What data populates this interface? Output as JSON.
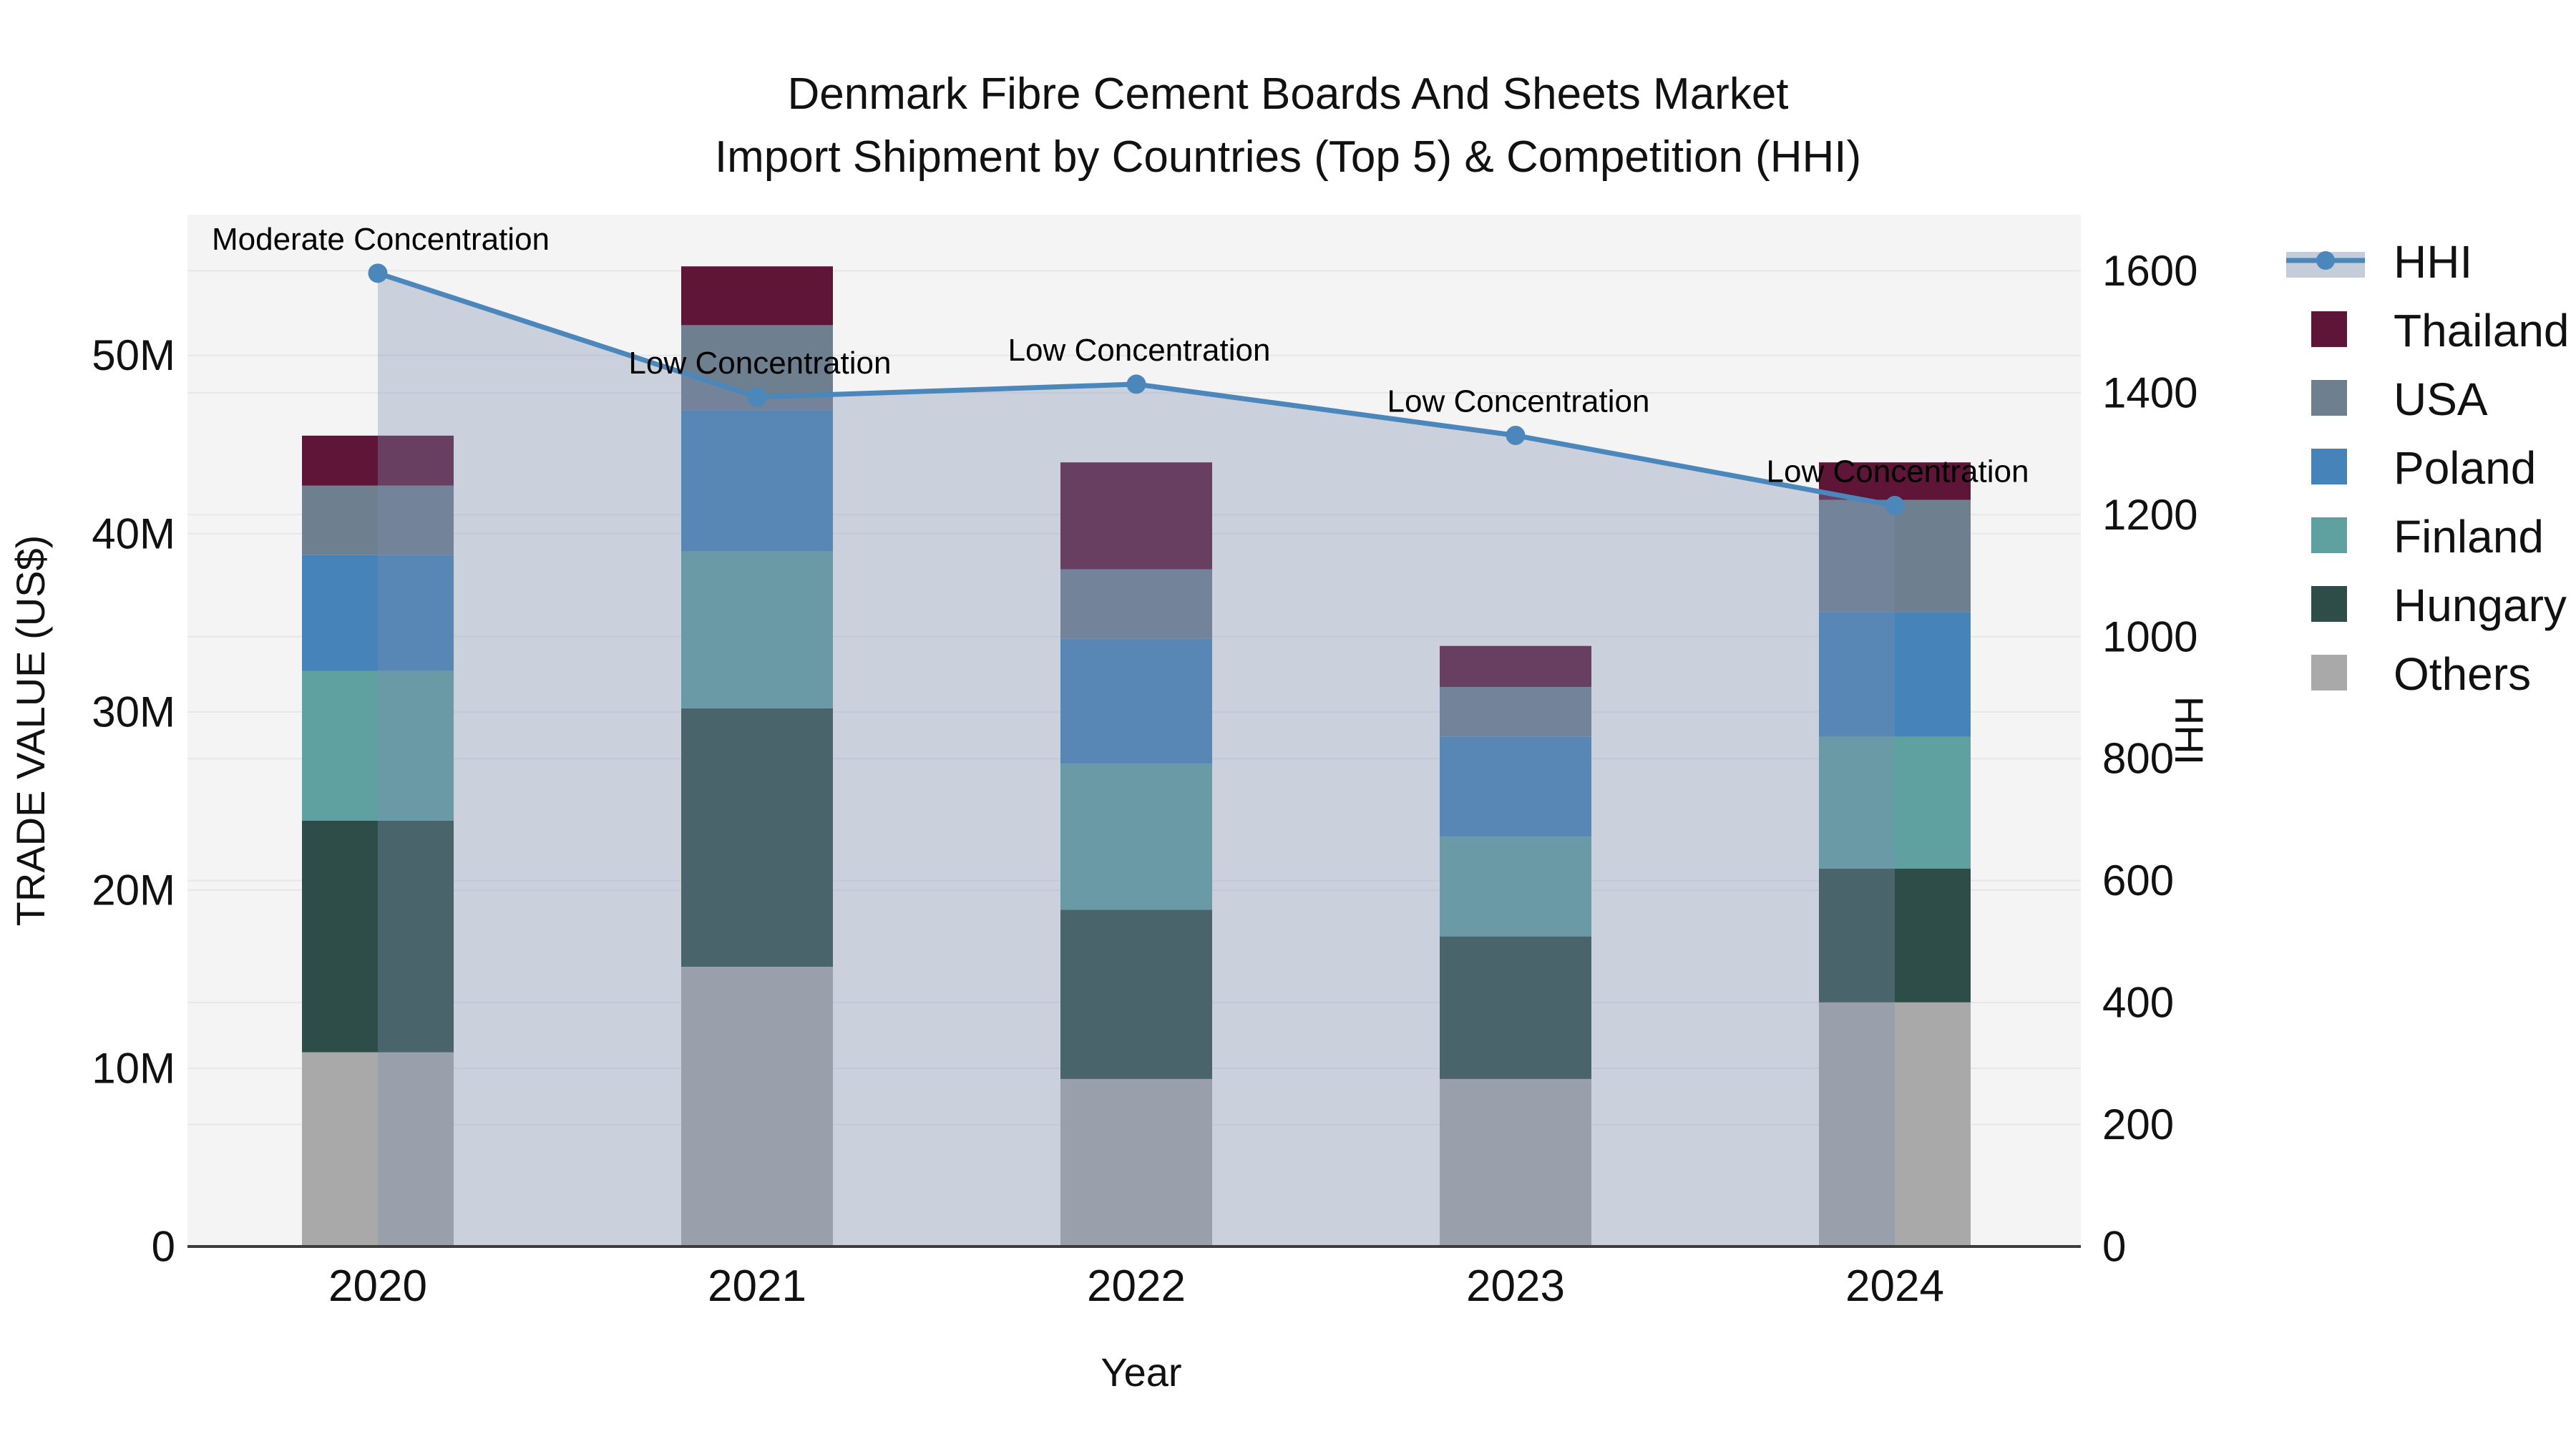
{
  "title": {
    "line1": "Denmark Fibre Cement Boards And Sheets Market",
    "line2": "Import Shipment by Countries (Top 5) & Competition (HHI)"
  },
  "axes": {
    "x": {
      "title": "Year",
      "categories": [
        "2020",
        "2021",
        "2022",
        "2023",
        "2024"
      ]
    },
    "y_left": {
      "title": "TRADE VALUE (US$)",
      "tick_labels": [
        "0",
        "10M",
        "20M",
        "30M",
        "40M",
        "50M"
      ],
      "tick_values_m": [
        0,
        10,
        20,
        30,
        40,
        50
      ],
      "range_m": [
        0,
        57.9
      ]
    },
    "y_right": {
      "title": "HHI",
      "tick_labels": [
        "0",
        "200",
        "400",
        "600",
        "800",
        "1000",
        "1200",
        "1400",
        "1600"
      ],
      "tick_values": [
        0,
        200,
        400,
        600,
        800,
        1000,
        1200,
        1400,
        1600
      ],
      "range": [
        0,
        1692
      ]
    }
  },
  "legend": {
    "items": [
      {
        "label": "HHI",
        "type": "line",
        "color": "#4b87bb"
      },
      {
        "label": "Thailand",
        "type": "swatch",
        "color": "#5e1538"
      },
      {
        "label": "USA",
        "type": "swatch",
        "color": "#6e7f8f"
      },
      {
        "label": "Poland",
        "type": "swatch",
        "color": "#4583b8"
      },
      {
        "label": "Finland",
        "type": "swatch",
        "color": "#5fa0a1"
      },
      {
        "label": "Hungary",
        "type": "swatch",
        "color": "#2e4d49"
      },
      {
        "label": "Others",
        "type": "swatch",
        "color": "#a9a9a9"
      }
    ]
  },
  "chart_data": {
    "type": "combo: stacked-bar + line-with-area",
    "x": [
      "2020",
      "2021",
      "2022",
      "2023",
      "2024"
    ],
    "bar_unit": "million US$ (trade value)",
    "bar_stack_order_bottom_to_top": [
      "Others",
      "Hungary",
      "Finland",
      "Poland",
      "USA",
      "Thailand"
    ],
    "bar_series": [
      {
        "name": "Others",
        "color": "#a9a9a9",
        "values": [
          10.9,
          15.7,
          9.4,
          9.4,
          13.7
        ]
      },
      {
        "name": "Hungary",
        "color": "#2e4d49",
        "values": [
          13.0,
          14.5,
          9.5,
          8.0,
          7.5
        ]
      },
      {
        "name": "Finland",
        "color": "#5fa0a1",
        "values": [
          8.4,
          8.8,
          8.2,
          5.6,
          7.4
        ]
      },
      {
        "name": "Poland",
        "color": "#4583b8",
        "values": [
          6.5,
          7.9,
          7.0,
          5.6,
          7.0
        ]
      },
      {
        "name": "USA",
        "color": "#6e7f8f",
        "values": [
          3.9,
          4.8,
          3.9,
          2.8,
          6.3
        ]
      },
      {
        "name": "Thailand",
        "color": "#5e1538",
        "values": [
          2.8,
          3.3,
          6.0,
          2.3,
          2.1
        ]
      }
    ],
    "bar_totals_m": [
      45.5,
      55.0,
      44.0,
      33.7,
      44.0
    ],
    "line_series": {
      "name": "HHI",
      "color": "#4b87bb",
      "area_fill": "rgba(127,144,175,0.35)",
      "values": [
        1596,
        1393,
        1414,
        1330,
        1215
      ]
    },
    "annotations": [
      {
        "text": "Moderate Concentration",
        "x": "2020"
      },
      {
        "text": "Low Concentration",
        "x": "2021"
      },
      {
        "text": "Low Concentration",
        "x": "2022"
      },
      {
        "text": "Low Concentration",
        "x": "2023"
      },
      {
        "text": "Low Concentration",
        "x": "2024"
      }
    ],
    "ylabel_left": "TRADE VALUE (US$)",
    "ylabel_right": "HHI",
    "xlabel": "Year",
    "grid": "horizontal gridlines for both axes",
    "legend_position": "right"
  },
  "colors": {
    "figure_bg": "#ffffff",
    "plot_bg": "#f4f4f4",
    "gridline": "#e7e7ea",
    "axis_line": "#3d3d3d",
    "text": "#111111",
    "annotation_text": "#000000"
  }
}
